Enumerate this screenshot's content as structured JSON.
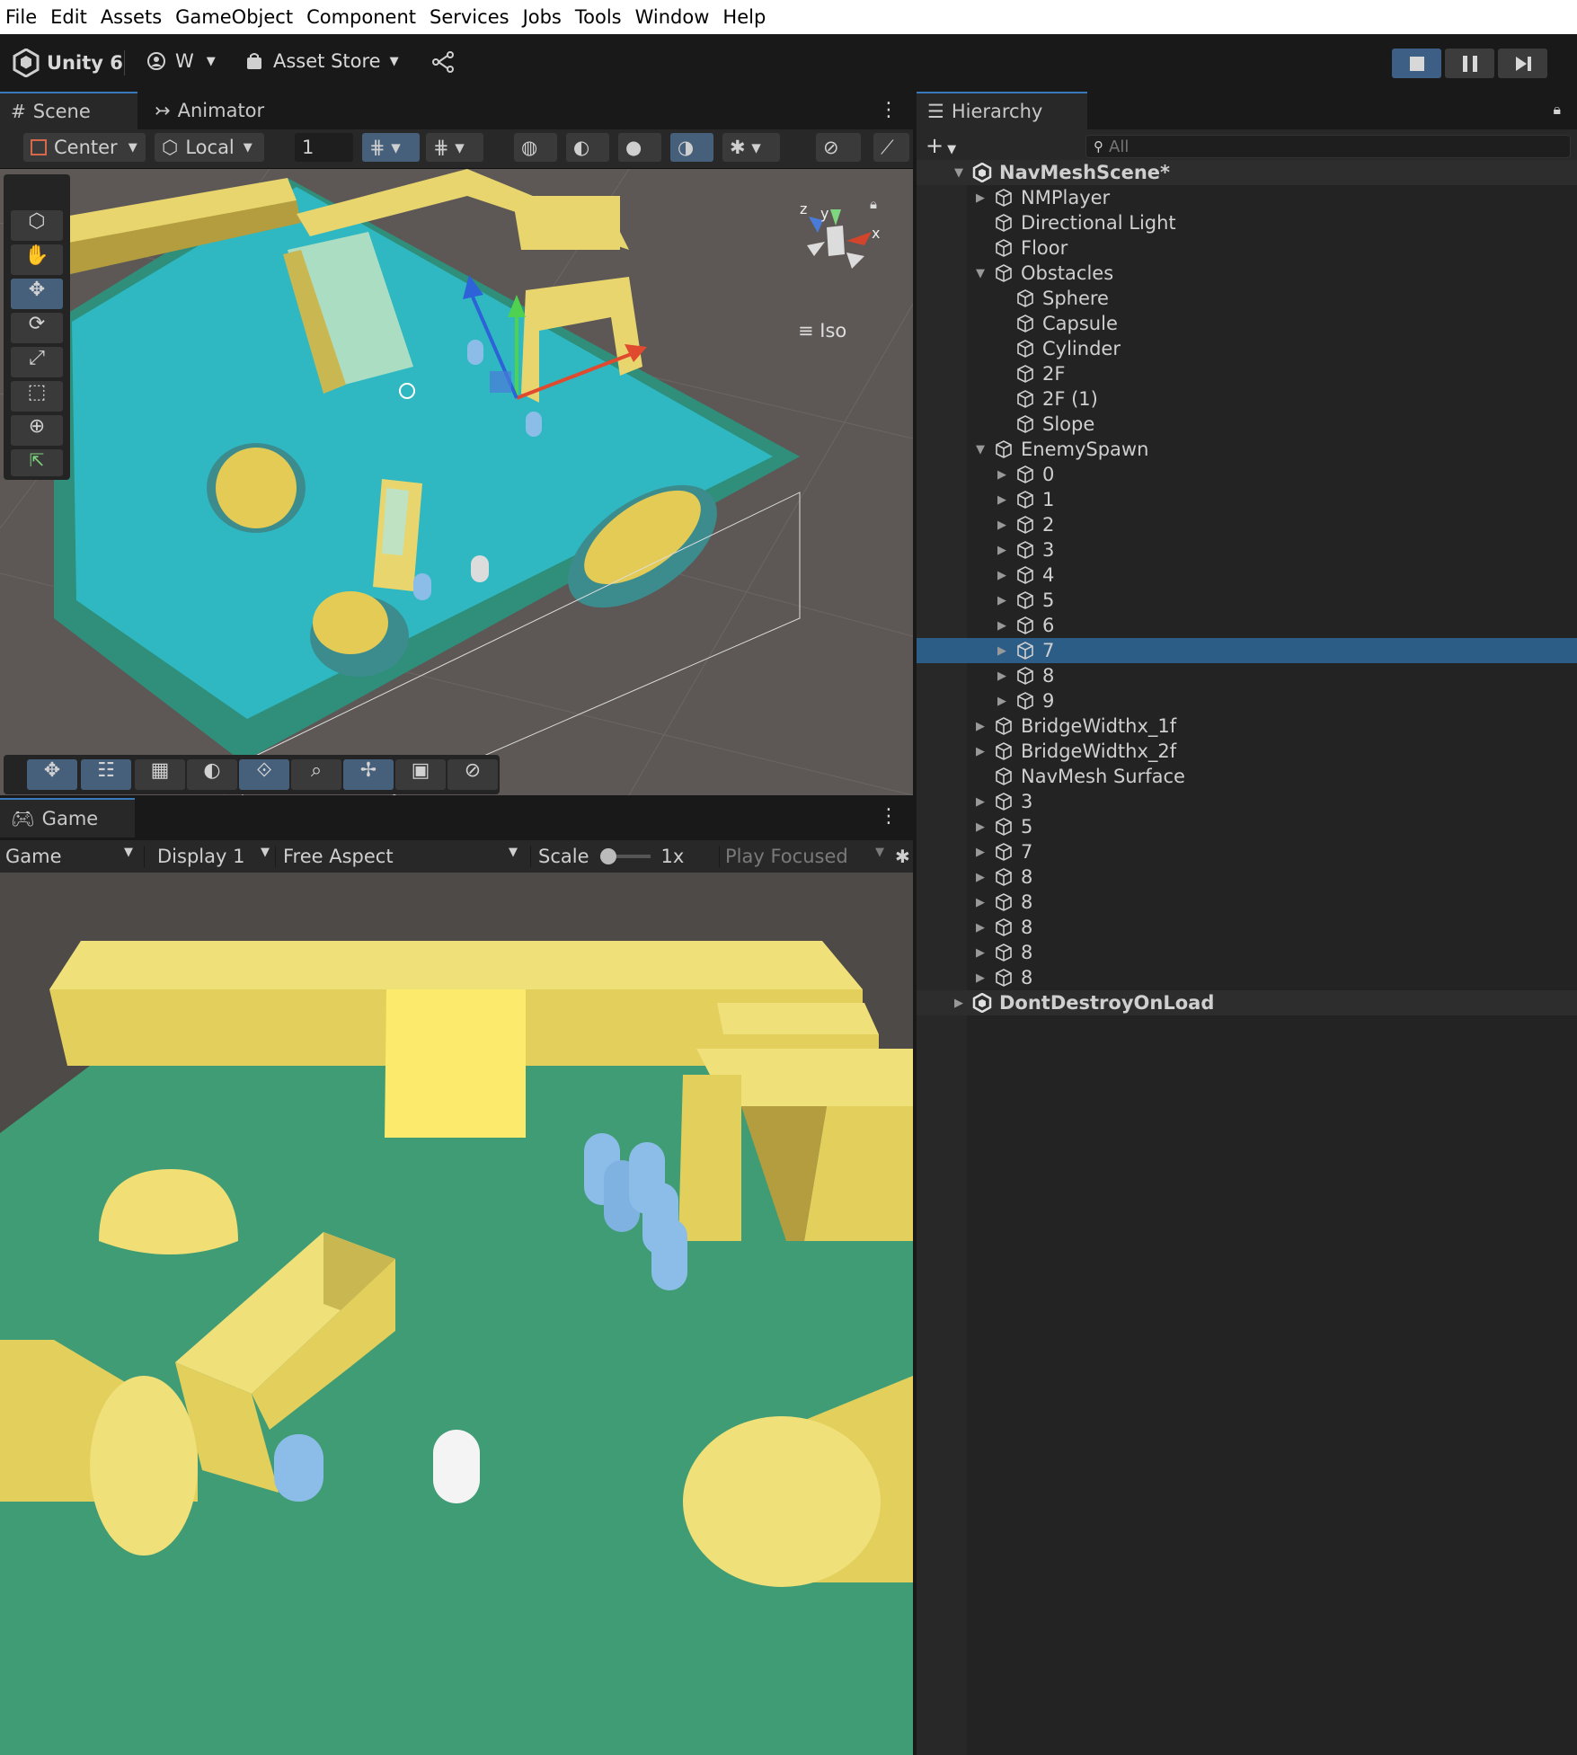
{
  "menu": [
    "File",
    "Edit",
    "Assets",
    "GameObject",
    "Component",
    "Services",
    "Jobs",
    "Tools",
    "Window",
    "Help"
  ],
  "toolbar": {
    "brand": "Unity 6",
    "account": "W",
    "asset_store": "Asset Store"
  },
  "scene_panel": {
    "tabs": [
      "Scene",
      "Animator"
    ],
    "pivot": "Center",
    "space": "Local",
    "grid_value": "1",
    "projection": "Iso",
    "gizmo_axes": {
      "x": "x",
      "y": "y",
      "z": "z"
    }
  },
  "game_panel": {
    "tab": "Game",
    "view_select": "Game",
    "display": "Display 1",
    "aspect": "Free Aspect",
    "scale_label": "Scale",
    "scale_value": "1x",
    "play_mode": "Play Focused"
  },
  "hierarchy": {
    "title": "Hierarchy",
    "search_placeholder": "All",
    "rows": [
      {
        "label": "NavMeshScene*",
        "depth": 0,
        "arrow": "down",
        "type": "scene"
      },
      {
        "label": "NMPlayer",
        "depth": 1,
        "arrow": "right"
      },
      {
        "label": "Directional Light",
        "depth": 1,
        "arrow": ""
      },
      {
        "label": "Floor",
        "depth": 1,
        "arrow": ""
      },
      {
        "label": "Obstacles",
        "depth": 1,
        "arrow": "down"
      },
      {
        "label": "Sphere",
        "depth": 2,
        "arrow": ""
      },
      {
        "label": "Capsule",
        "depth": 2,
        "arrow": ""
      },
      {
        "label": "Cylinder",
        "depth": 2,
        "arrow": ""
      },
      {
        "label": "2F",
        "depth": 2,
        "arrow": ""
      },
      {
        "label": "2F (1)",
        "depth": 2,
        "arrow": ""
      },
      {
        "label": "Slope",
        "depth": 2,
        "arrow": ""
      },
      {
        "label": "EnemySpawn",
        "depth": 1,
        "arrow": "down"
      },
      {
        "label": "0",
        "depth": 2,
        "arrow": "right"
      },
      {
        "label": "1",
        "depth": 2,
        "arrow": "right"
      },
      {
        "label": "2",
        "depth": 2,
        "arrow": "right"
      },
      {
        "label": "3",
        "depth": 2,
        "arrow": "right"
      },
      {
        "label": "4",
        "depth": 2,
        "arrow": "right"
      },
      {
        "label": "5",
        "depth": 2,
        "arrow": "right"
      },
      {
        "label": "6",
        "depth": 2,
        "arrow": "right"
      },
      {
        "label": "7",
        "depth": 2,
        "arrow": "right",
        "selected": true
      },
      {
        "label": "8",
        "depth": 2,
        "arrow": "right"
      },
      {
        "label": "9",
        "depth": 2,
        "arrow": "right"
      },
      {
        "label": "BridgeWidthx_1f",
        "depth": 1,
        "arrow": "right"
      },
      {
        "label": "BridgeWidthx_2f",
        "depth": 1,
        "arrow": "right"
      },
      {
        "label": "NavMesh Surface",
        "depth": 1,
        "arrow": ""
      },
      {
        "label": "3",
        "depth": 1,
        "arrow": "right"
      },
      {
        "label": "5",
        "depth": 1,
        "arrow": "right"
      },
      {
        "label": "7",
        "depth": 1,
        "arrow": "right"
      },
      {
        "label": "8",
        "depth": 1,
        "arrow": "right"
      },
      {
        "label": "8",
        "depth": 1,
        "arrow": "right"
      },
      {
        "label": "8",
        "depth": 1,
        "arrow": "right"
      },
      {
        "label": "8",
        "depth": 1,
        "arrow": "right"
      },
      {
        "label": "8",
        "depth": 1,
        "arrow": "right"
      },
      {
        "label": "DontDestroyOnLoad",
        "depth": 0,
        "arrow": "right",
        "type": "scene"
      }
    ]
  },
  "colors": {
    "selection": "#2c5d87",
    "navmesh": "#2fb8c2",
    "obstacle": "#e8d56e",
    "game_floor": "#3f9c74",
    "agent": "#8cbde8"
  }
}
